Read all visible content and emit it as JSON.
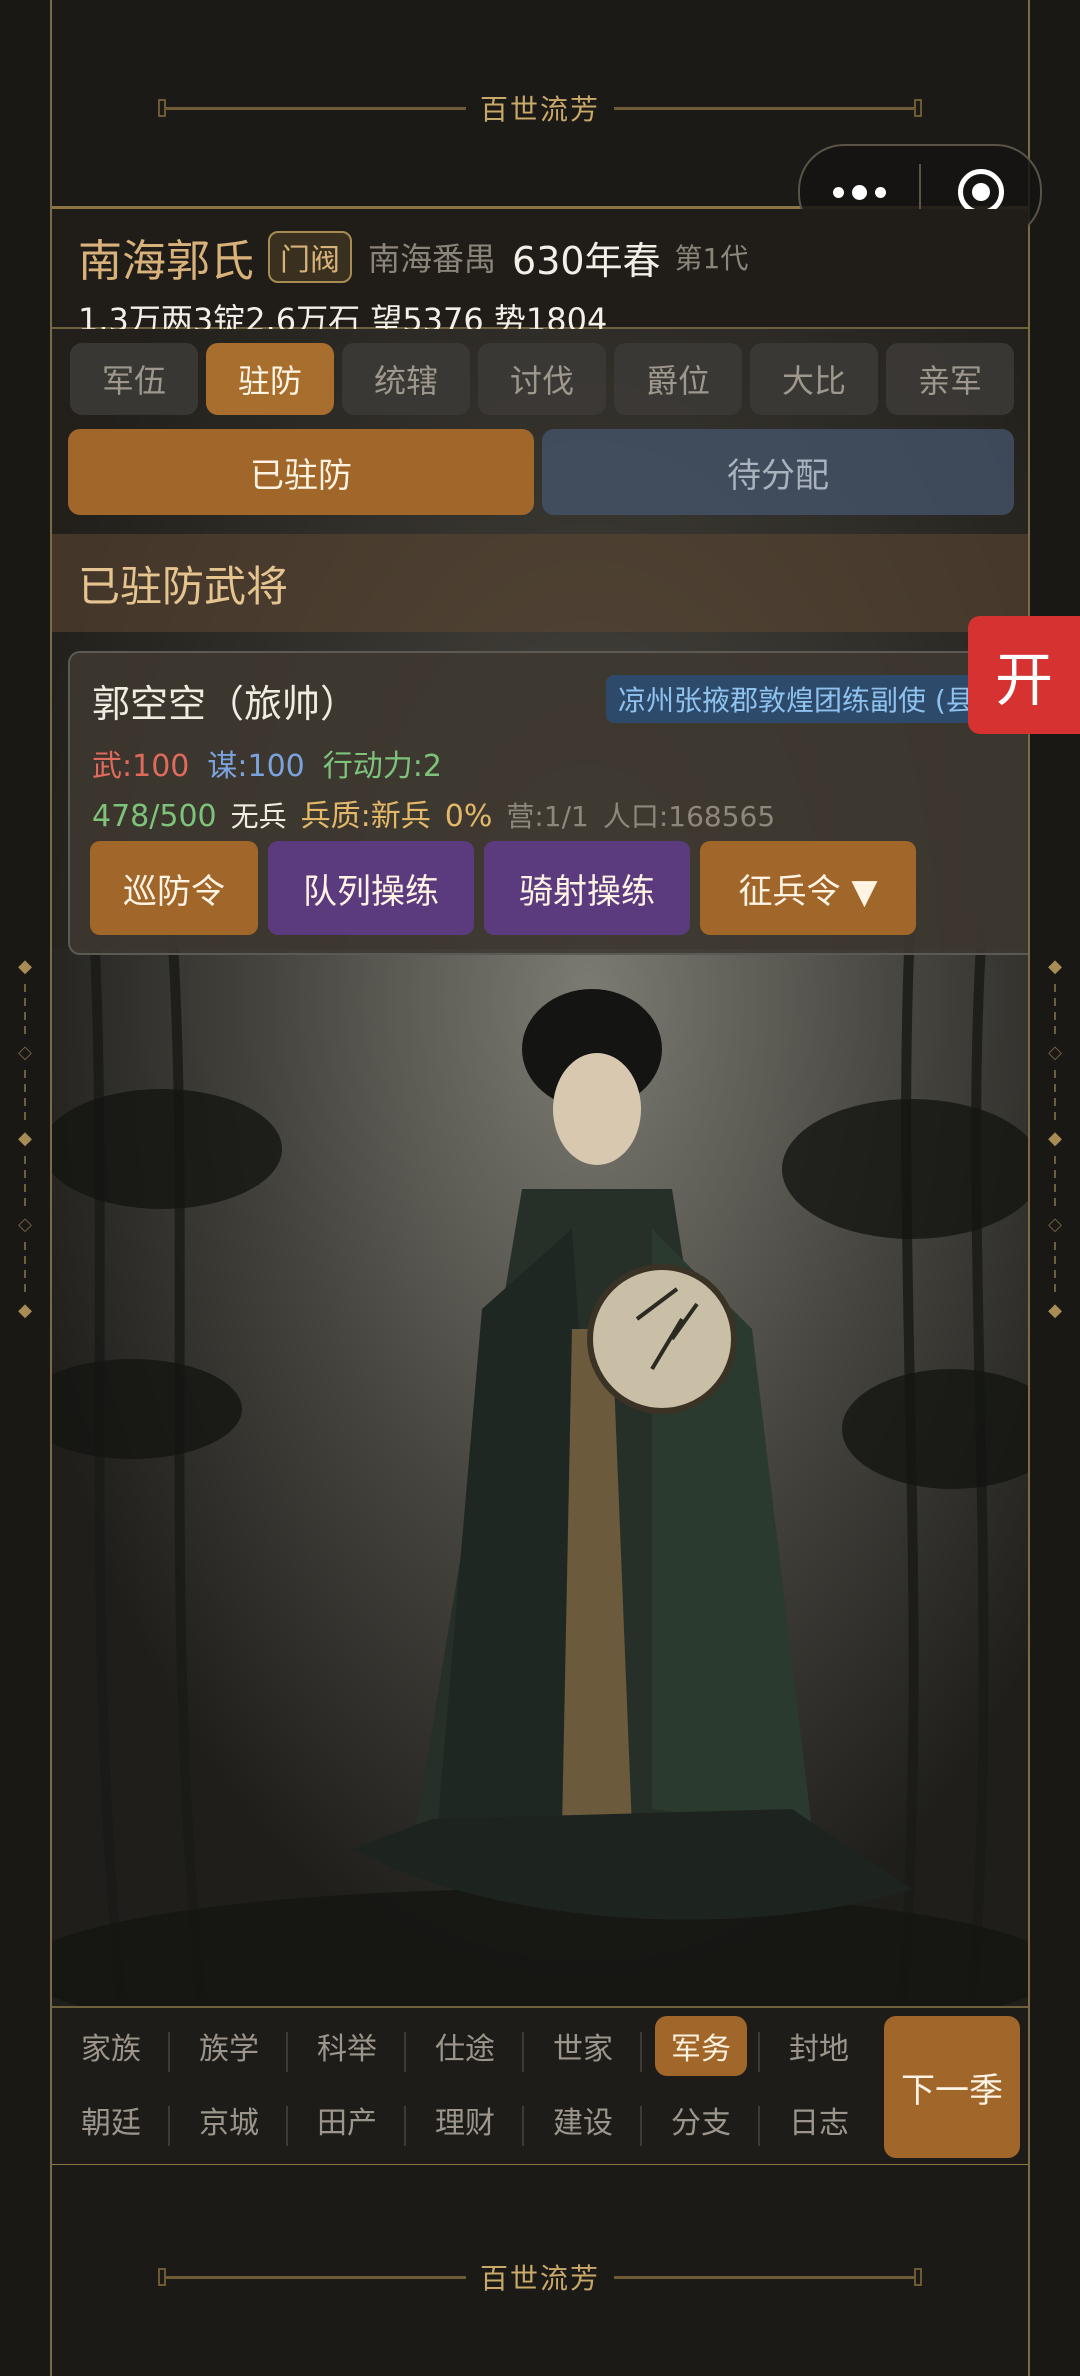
{
  "banner": {
    "title": "百世流芳"
  },
  "capsule": {
    "menu_icon": "more-dots-icon",
    "close_icon": "target-icon"
  },
  "header": {
    "clan_name": "南海郭氏",
    "clan_rank": "门阀",
    "location": "南海番禺",
    "year": "630年春",
    "generation": "第1代",
    "resources": "1.3万两3锭2.6万石  望5376 势1804"
  },
  "tabs": [
    "军伍",
    "驻防",
    "统辖",
    "讨伐",
    "爵位",
    "大比",
    "亲军"
  ],
  "active_tab": "驻防",
  "subtabs": {
    "assigned": "已驻防",
    "pending": "待分配"
  },
  "section_title": "已驻防武将",
  "general": {
    "name": "郭空空（旅帅）",
    "post": "凉州张掖郡敦煌团练副使 (县",
    "martial": "武:100",
    "strategy": "谋:100",
    "action": "行动力:2",
    "troops": "478/500",
    "soldier_type": "无兵",
    "quality": "兵质:新兵",
    "quality_pct": "0%",
    "camp": "营:1/1",
    "population": "人口:168565",
    "actions": [
      "巡防令",
      "队列操练",
      "骑射操练",
      "征兵令 ▼"
    ]
  },
  "open_button": "开",
  "bottom_nav": {
    "row1": [
      "家族",
      "族学",
      "科举",
      "仕途",
      "世家",
      "军务",
      "封地"
    ],
    "row2": [
      "朝廷",
      "京城",
      "田产",
      "理财",
      "建设",
      "分支",
      "日志"
    ],
    "active": "军务",
    "next": "下一季"
  },
  "colors": {
    "accent": "#a0662a",
    "frame": "#8c7444",
    "open_red": "#d63232"
  }
}
